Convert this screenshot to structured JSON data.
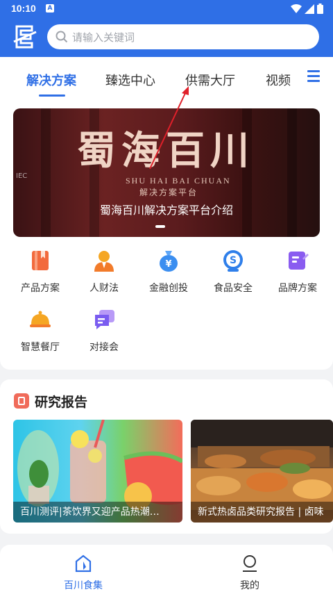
{
  "status_bar": {
    "time": "10:10",
    "notif_badge": "A"
  },
  "search": {
    "placeholder": "请输入关键词"
  },
  "tabs": [
    {
      "label": "解决方案",
      "active": true
    },
    {
      "label": "臻选中心",
      "active": false
    },
    {
      "label": "供需大厅",
      "active": false
    },
    {
      "label": "视频",
      "active": false
    }
  ],
  "banner": {
    "calligraphy": "蜀海百川",
    "pinyin": "SHU HAI BAI CHUAN",
    "subtitle": "解决方案平台",
    "caption": "蜀海百川解决方案平台介绍"
  },
  "categories": [
    {
      "label": "产品方案",
      "icon": "book-icon",
      "color": "#f26a3d"
    },
    {
      "label": "人财法",
      "icon": "person-icon",
      "color": "#f5a623"
    },
    {
      "label": "金融创投",
      "icon": "money-bag-icon",
      "color": "#3b8ef0"
    },
    {
      "label": "食品安全",
      "icon": "safety-s-icon",
      "color": "#2f7fea"
    },
    {
      "label": "品牌方案",
      "icon": "brand-edit-icon",
      "color": "#8a5cf0"
    },
    {
      "label": "智慧餐厅",
      "icon": "cloche-icon",
      "color": "#f5a623"
    },
    {
      "label": "对接会",
      "icon": "chat-bubbles-icon",
      "color": "#7a5cf0"
    }
  ],
  "report": {
    "title": "研究报告",
    "items": [
      {
        "caption": "百川测评|茶饮界又迎产品热潮…"
      },
      {
        "caption": "新式热卤品类研究报告 | 卤味"
      }
    ]
  },
  "bottom_nav": [
    {
      "label": "百川食集",
      "active": true,
      "icon": "home-icon"
    },
    {
      "label": "我的",
      "active": false,
      "icon": "profile-icon"
    }
  ],
  "colors": {
    "brand_blue": "#2f6fe6"
  }
}
